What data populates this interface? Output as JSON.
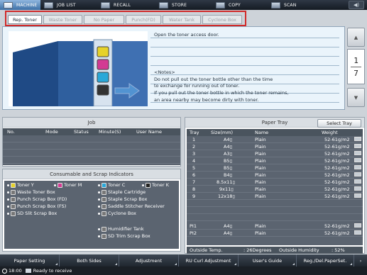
{
  "top_nav": {
    "tabs": [
      {
        "label": "MACHINE",
        "active": true
      },
      {
        "label": "JOB LIST",
        "active": false
      },
      {
        "label": "RECALL",
        "active": false
      },
      {
        "label": "STORE",
        "active": false
      },
      {
        "label": "COPY",
        "active": false
      },
      {
        "label": "SCAN",
        "active": false
      }
    ],
    "speaker_icon": "speaker-icon"
  },
  "category_tabs": [
    {
      "label": "Rep. Toner",
      "active": true
    },
    {
      "label": "Waste Toner",
      "active": false
    },
    {
      "label": "No Paper",
      "active": false
    },
    {
      "label": "Punch(FD)",
      "active": false
    },
    {
      "label": "Water Tank",
      "active": false
    },
    {
      "label": "Cyclone Box",
      "active": false
    }
  ],
  "guide": {
    "instruction": "Open the toner access door.",
    "notes_title": "<Notes>",
    "notes": [
      "Do not pull out the toner bottle other than the time",
      "to exchange for running out of toner.",
      "If you pull out the toner bottle in which the toner remains,",
      "an area nearby may become dirty with toner."
    ],
    "page_current": "1",
    "page_total": "7"
  },
  "job_panel": {
    "title": "Job",
    "columns": [
      "No.",
      "Mode",
      "Status",
      "Minute(S)",
      "User Name"
    ]
  },
  "consumables": {
    "title": "Consumable and Scrap Indicators",
    "left": [
      {
        "label": "Toner Y",
        "color": "#e6d22a"
      },
      {
        "label": "Toner M",
        "color": "#d33a93"
      },
      {
        "label": "Waste Toner Box",
        "color": ""
      },
      {
        "label": "Punch Scrap Box (FD)",
        "color": ""
      },
      {
        "label": "Punch Scrap Box (FS)",
        "color": ""
      },
      {
        "label": "SD Slit Scrap Box",
        "color": ""
      }
    ],
    "right": [
      {
        "label": "Toner C",
        "color": "#2aa8d8"
      },
      {
        "label": "Toner K",
        "color": "#222222"
      },
      {
        "label": "Staple Cartridge"
      },
      {
        "label": "Staple Scrap Box"
      },
      {
        "label": "Saddle Stitcher Receiver"
      },
      {
        "label": "Cyclone Box"
      },
      {
        "label": "Humidifier Tank"
      },
      {
        "label": "SD Trim Scrap Box"
      }
    ]
  },
  "paper_tray": {
    "title": "Paper Tray",
    "select_label": "Select Tray",
    "columns": [
      "Tray",
      "Size(mm)",
      "Name",
      "Weight"
    ],
    "rows": [
      {
        "tray": "1",
        "size": "A4▯",
        "name": "Plain",
        "weight": "52-61g/m2"
      },
      {
        "tray": "2",
        "size": "A4▯",
        "name": "Plain",
        "weight": "52-61g/m2"
      },
      {
        "tray": "3",
        "size": "A3▯",
        "name": "Plain",
        "weight": "52-61g/m2"
      },
      {
        "tray": "4",
        "size": "B5▯",
        "name": "Plain",
        "weight": "52-61g/m2"
      },
      {
        "tray": "5",
        "size": "B5▯",
        "name": "Plain",
        "weight": "52-61g/m2"
      },
      {
        "tray": "6",
        "size": "B4▯",
        "name": "Plain",
        "weight": "52-61g/m2"
      },
      {
        "tray": "7",
        "size": "8.5x11▯",
        "name": "Plain",
        "weight": "52-61g/m2"
      },
      {
        "tray": "8",
        "size": "9x11▯",
        "name": "Plain",
        "weight": "52-61g/m2"
      },
      {
        "tray": "9",
        "size": "12x18▯",
        "name": "Plain",
        "weight": "52-61g/m2"
      },
      {
        "tray": "PI1",
        "size": "A4▯",
        "name": "Plain",
        "weight": "52-61g/m2"
      },
      {
        "tray": "PI2",
        "size": "A4▯",
        "name": "Plain",
        "weight": "52-61g/m2"
      }
    ],
    "outside_temp_label": "Outside Temp.",
    "outside_temp_value": ": 26Degrees",
    "outside_humidity_label": "Outside Humidity",
    "outside_humidity_value": ": 52%"
  },
  "bottom_bar": [
    "Paper Setting",
    "Both Sides",
    "Adjustment",
    "RU Curl Adjustment",
    "User's Guide",
    "Reg./Del.PaperSet."
  ],
  "status": {
    "time": "18:00",
    "message": "Ready to receive"
  }
}
